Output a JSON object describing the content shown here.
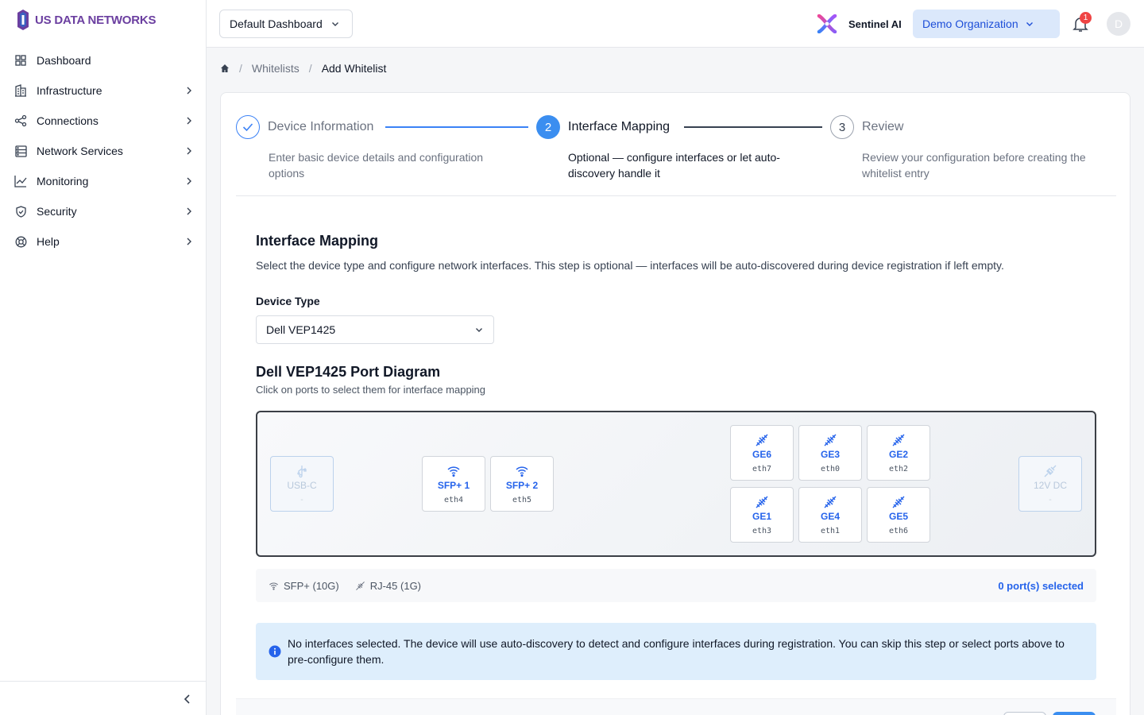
{
  "app": {
    "brand": "US DATA NETWORKS"
  },
  "sidebar": {
    "items": [
      {
        "label": "Dashboard",
        "icon": "grid-icon",
        "has_children": false
      },
      {
        "label": "Infrastructure",
        "icon": "building-icon",
        "has_children": true
      },
      {
        "label": "Connections",
        "icon": "share-icon",
        "has_children": true
      },
      {
        "label": "Network Services",
        "icon": "server-icon",
        "has_children": true
      },
      {
        "label": "Monitoring",
        "icon": "chart-line-icon",
        "has_children": true
      },
      {
        "label": "Security",
        "icon": "shield-icon",
        "has_children": true
      },
      {
        "label": "Help",
        "icon": "lifebuoy-icon",
        "has_children": true
      }
    ]
  },
  "topbar": {
    "dashboard_select": "Default Dashboard",
    "assistant_label": "Sentinel AI",
    "org_select": "Demo Organization",
    "notification_count": "1",
    "avatar_initial": "D"
  },
  "breadcrumb": {
    "items": [
      "Whitelists",
      "Add Whitelist"
    ]
  },
  "stepper": {
    "steps": [
      {
        "number": "",
        "title": "Device Information",
        "description": "Enter basic device details and configuration options",
        "state": "done"
      },
      {
        "number": "2",
        "title": "Interface Mapping",
        "description": "Optional — configure interfaces or let auto-discovery handle it",
        "state": "active"
      },
      {
        "number": "3",
        "title": "Review",
        "description": "Review your configuration before creating the whitelist entry",
        "state": "pending"
      }
    ]
  },
  "interface_mapping": {
    "title": "Interface Mapping",
    "description": "Select the device type and configure network interfaces. This step is optional — interfaces will be auto-discovered during device registration if left empty.",
    "device_type_label": "Device Type",
    "device_type_value": "Dell VEP1425",
    "diagram_title": "Dell VEP1425 Port Diagram",
    "diagram_subtitle": "Click on ports to select them for interface mapping"
  },
  "ports": {
    "usb": {
      "name": "USB-C",
      "sub": "-"
    },
    "sfp": [
      {
        "name": "SFP+ 1",
        "sub": "eth4"
      },
      {
        "name": "SFP+ 2",
        "sub": "eth5"
      }
    ],
    "rj45_top": [
      {
        "name": "GE6",
        "sub": "eth7"
      },
      {
        "name": "GE3",
        "sub": "eth0"
      },
      {
        "name": "GE2",
        "sub": "eth2"
      }
    ],
    "rj45_bottom": [
      {
        "name": "GE1",
        "sub": "eth3"
      },
      {
        "name": "GE4",
        "sub": "eth1"
      },
      {
        "name": "GE5",
        "sub": "eth6"
      }
    ],
    "power": {
      "name": "12V DC",
      "sub": "-"
    }
  },
  "legend": {
    "sfp_label": "SFP+ (10G)",
    "rj45_label": "RJ-45 (1G)",
    "selected_count": "0 port(s) selected"
  },
  "info": {
    "text": "No interfaces selected. The device will use auto-discovery to detect and configure interfaces during registration. You can skip this step or select ports above to pre-configure them."
  },
  "colors": {
    "brand": "#6b3fa0",
    "accent": "#3b8ef0",
    "link": "#2563eb",
    "info_bg": "#deeefc"
  }
}
